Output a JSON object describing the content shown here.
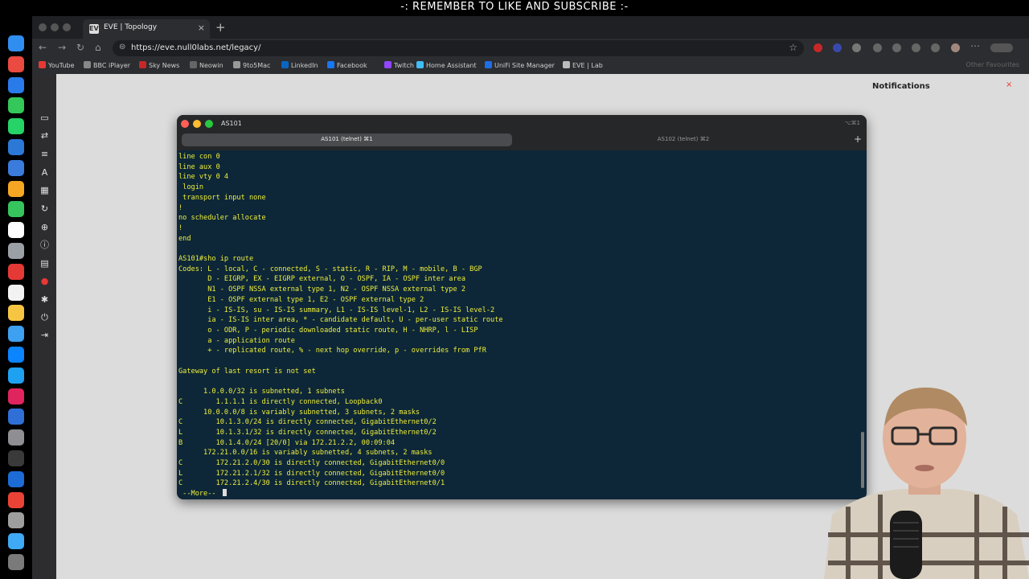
{
  "banner": "-: REMEMBER TO LIKE AND SUBSCRIBE :-",
  "browser": {
    "tab_title": "EVE | Topology",
    "tab_favicon": "EVE",
    "url": "https://eve.null0labs.net/legacy/",
    "bookmarks": [
      {
        "label": "YouTube",
        "color": "#e53935"
      },
      {
        "label": "BBC iPlayer",
        "color": "#888888"
      },
      {
        "label": "Sky News",
        "color": "#c62828"
      },
      {
        "label": "Neowin",
        "color": "#666666"
      },
      {
        "label": "9to5Mac",
        "color": "#999999"
      },
      {
        "label": "LinkedIn",
        "color": "#0a66c2"
      },
      {
        "label": "Facebook",
        "color": "#1877f2"
      },
      {
        "label": "Twitch",
        "color": "#9146ff"
      },
      {
        "label": "Home Assistant",
        "color": "#41bdf5"
      },
      {
        "label": "UniFi Site Manager",
        "color": "#1e6ee8"
      },
      {
        "label": "EVE | Lab",
        "color": "#bbbbbb"
      }
    ],
    "other_bookmarks": "Other Favourites"
  },
  "page": {
    "notifications_title": "Notifications",
    "close_glyph": "×"
  },
  "terminal": {
    "window_title": "AS101",
    "window_shortcut": "⌥⌘1",
    "tabs": [
      {
        "label": "AS101 (telnet)  ⌘1",
        "active": true
      },
      {
        "label": "AS102 (telnet)  ⌘2",
        "active": false
      }
    ],
    "new_tab": "+",
    "lines": [
      "line con 0",
      "line aux 0",
      "line vty 0 4",
      " login",
      " transport input none",
      "!",
      "no scheduler allocate",
      "!",
      "end",
      "",
      "AS101#sho ip route",
      "Codes: L - local, C - connected, S - static, R - RIP, M - mobile, B - BGP",
      "       D - EIGRP, EX - EIGRP external, O - OSPF, IA - OSPF inter area",
      "       N1 - OSPF NSSA external type 1, N2 - OSPF NSSA external type 2",
      "       E1 - OSPF external type 1, E2 - OSPF external type 2",
      "       i - IS-IS, su - IS-IS summary, L1 - IS-IS level-1, L2 - IS-IS level-2",
      "       ia - IS-IS inter area, * - candidate default, U - per-user static route",
      "       o - ODR, P - periodic downloaded static route, H - NHRP, l - LISP",
      "       a - application route",
      "       + - replicated route, % - next hop override, p - overrides from PfR",
      "",
      "Gateway of last resort is not set",
      "",
      "      1.0.0.0/32 is subnetted, 1 subnets",
      "C        1.1.1.1 is directly connected, Loopback0",
      "      10.0.0.0/8 is variably subnetted, 3 subnets, 2 masks",
      "C        10.1.3.0/24 is directly connected, GigabitEthernet0/2",
      "L        10.1.3.1/32 is directly connected, GigabitEthernet0/2",
      "B        10.1.4.0/24 [20/0] via 172.21.2.2, 00:09:04",
      "      172.21.0.0/16 is variably subnetted, 4 subnets, 2 masks",
      "C        172.21.2.0/30 is directly connected, GigabitEthernet0/0",
      "L        172.21.2.1/32 is directly connected, GigabitEthernet0/0",
      "C        172.21.2.4/30 is directly connected, GigabitEthernet0/1"
    ],
    "more_prompt": " --More-- "
  },
  "colors": {
    "terminal_bg": "#0d2738",
    "terminal_text": "#eeee3a",
    "page_bg": "#dcdcdc"
  }
}
